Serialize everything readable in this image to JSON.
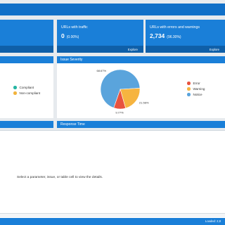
{
  "tiles": [
    {
      "title": "",
      "value": "",
      "percent": "",
      "footer": ""
    },
    {
      "title": "URLs with traffic",
      "value": "0",
      "percent": "(0.00%)",
      "footer": "Explore"
    },
    {
      "title": "URLs with errors and warnings",
      "value": "2,734",
      "percent": "(96.30%)",
      "footer": "Explore"
    }
  ],
  "compliance_panel": {
    "title": "",
    "legend": [
      {
        "label": "Compliant",
        "color": "#26b5a3"
      },
      {
        "label": "Non-compliant",
        "color": "#f2b33d"
      }
    ]
  },
  "severity_panel": {
    "title": "Issue Severity",
    "legend": [
      {
        "label": "Error",
        "color": "#e8533f"
      },
      {
        "label": "Warning",
        "color": "#f6b440"
      },
      {
        "label": "Notice",
        "color": "#5aa4dc"
      }
    ]
  },
  "response_panel": {
    "title": "Response Time"
  },
  "left_bottom_panel": {
    "title": ""
  },
  "details_message": "Select a parameter, issue, or table cell to view the details.",
  "statusbar": {
    "text": "Loaded: 2,8"
  },
  "chart_data": {
    "type": "pie",
    "title": "Issue Severity",
    "categories": [
      "Notice",
      "Warning",
      "Error"
    ],
    "values": [
      68.67,
      21.56,
      9.77
    ],
    "labels": [
      "68.67%",
      "21.56%",
      "9.77%"
    ],
    "colors": [
      "#5aa4dc",
      "#f6b440",
      "#e8533f"
    ],
    "legend": "right"
  }
}
